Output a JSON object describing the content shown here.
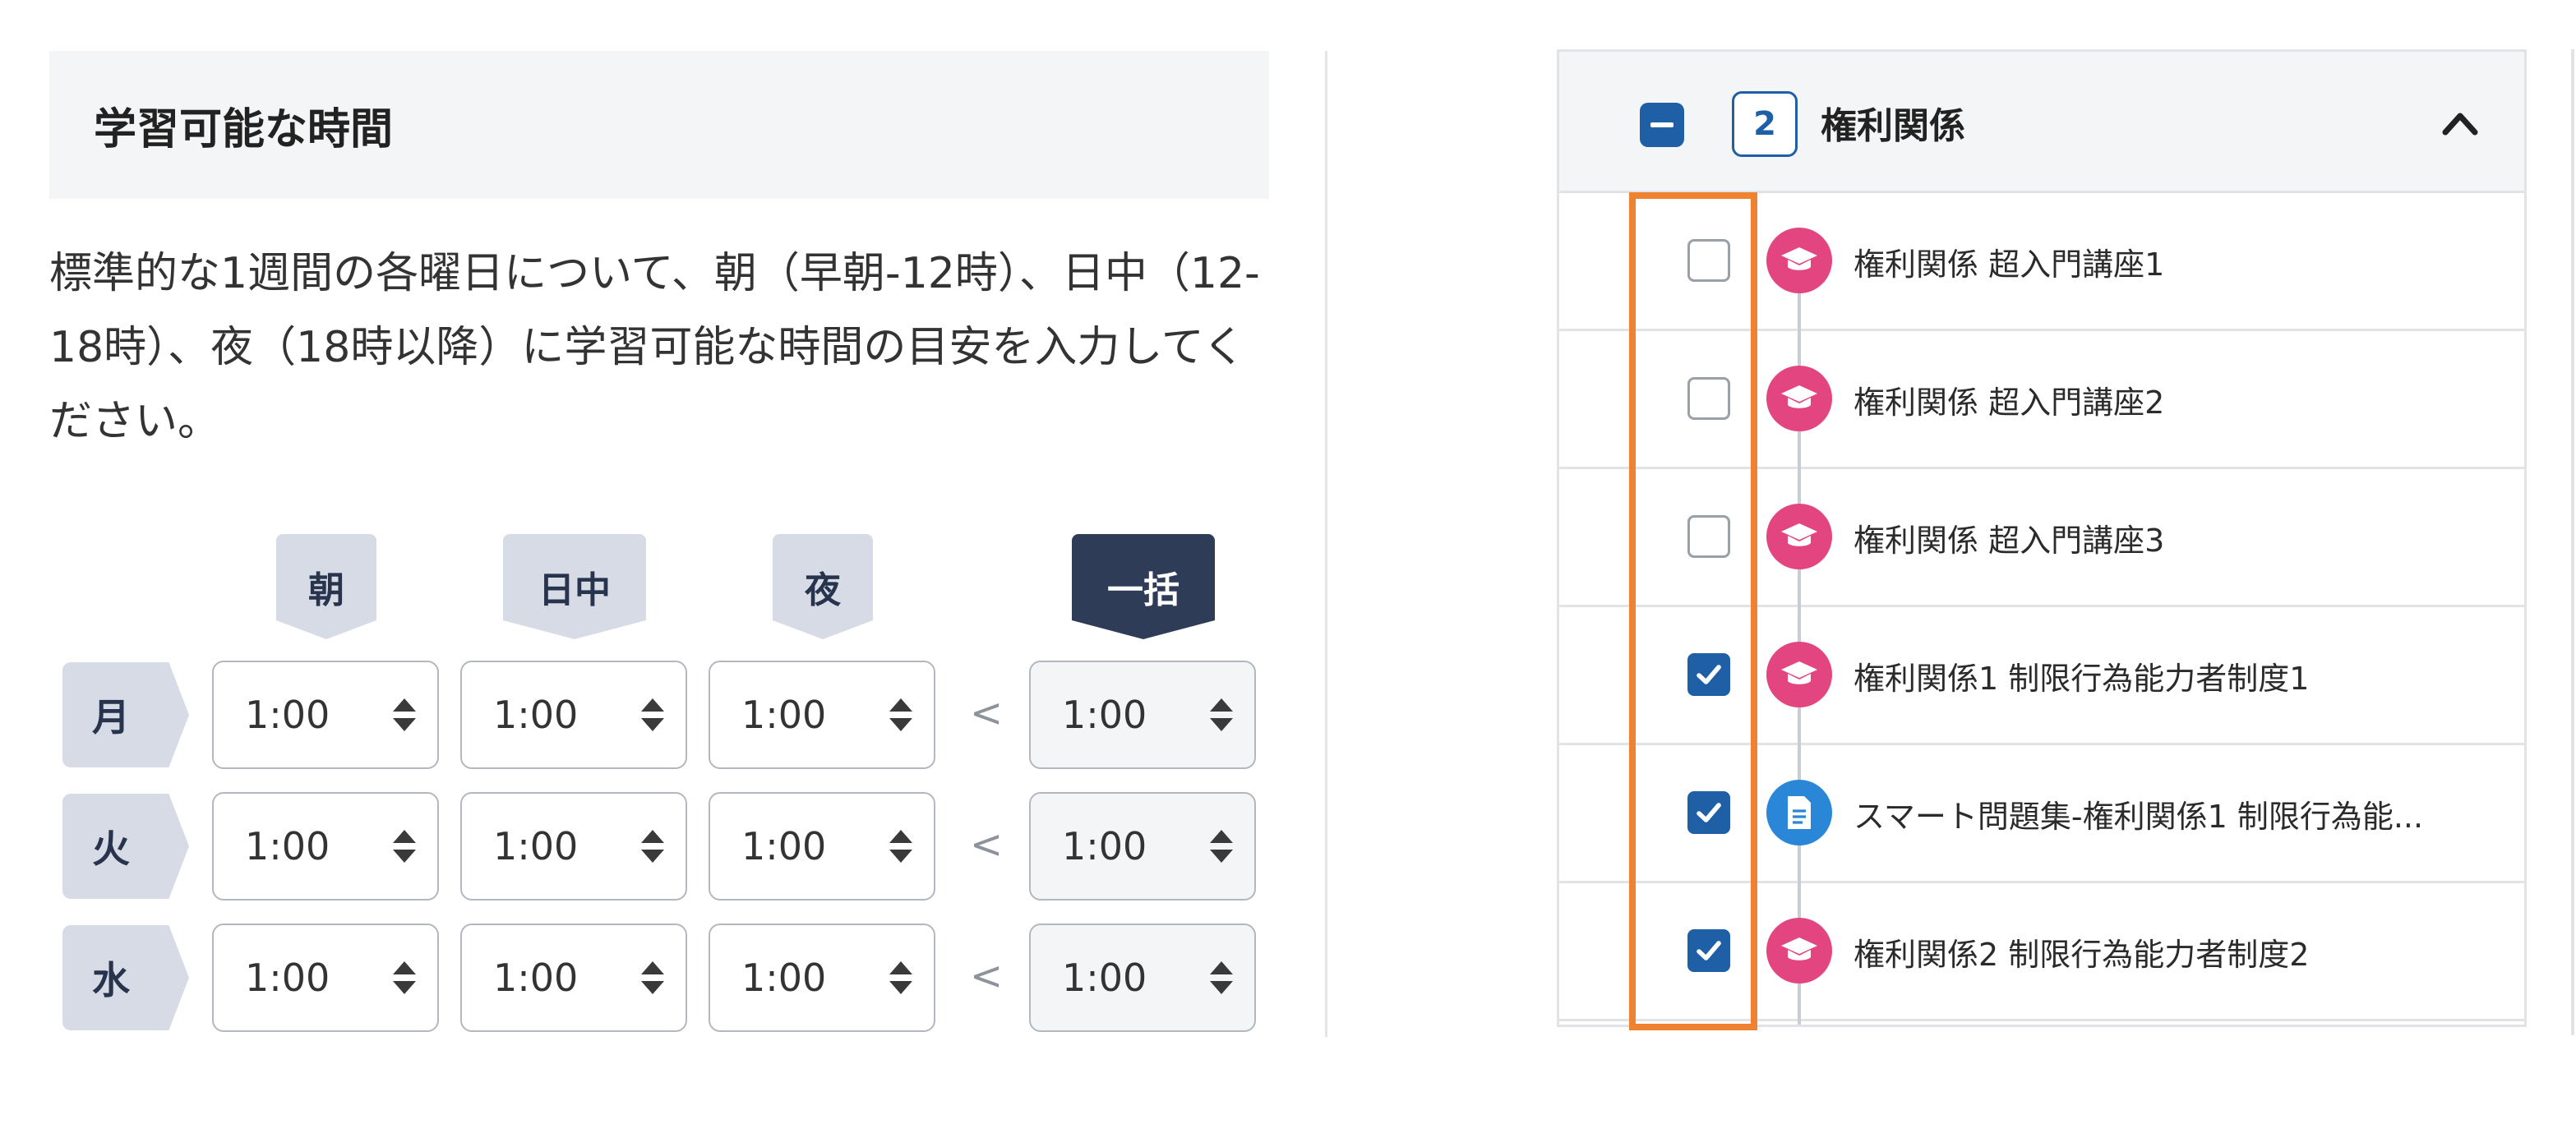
{
  "left_panel": {
    "title": "学習可能な時間",
    "description": "標準的な1週間の各曜日について、朝（早朝-12時）、日中（12-18時）、夜（18時以降）に学習可能な時間の目安を入力してください。",
    "columns": [
      "朝",
      "日中",
      "夜",
      "一括"
    ],
    "separator": "<",
    "rows": [
      {
        "day": "月",
        "morning": "1:00",
        "daytime": "1:00",
        "night": "1:00",
        "bulk": "1:00"
      },
      {
        "day": "火",
        "morning": "1:00",
        "daytime": "1:00",
        "night": "1:00",
        "bulk": "1:00"
      },
      {
        "day": "水",
        "morning": "1:00",
        "daytime": "1:00",
        "night": "1:00",
        "bulk": "1:00"
      }
    ]
  },
  "right_panel": {
    "section_number": "2",
    "section_title": "権利関係",
    "items": [
      {
        "label": "権利関係 超入門講座1",
        "checked": false,
        "icon": "graduation-cap-icon"
      },
      {
        "label": "権利関係 超入門講座2",
        "checked": false,
        "icon": "graduation-cap-icon"
      },
      {
        "label": "権利関係 超入門講座3",
        "checked": false,
        "icon": "graduation-cap-icon"
      },
      {
        "label": "権利関係1 制限行為能力者制度1",
        "checked": true,
        "icon": "graduation-cap-icon"
      },
      {
        "label": "スマート問題集-権利関係1 制限行為能...",
        "checked": true,
        "icon": "document-icon"
      },
      {
        "label": "権利関係2 制限行為能力者制度2",
        "checked": true,
        "icon": "graduation-cap-icon"
      }
    ]
  },
  "colors": {
    "accent_blue": "#1f5fa6",
    "lecture_pink": "#e2457f",
    "document_blue": "#2a86d7",
    "highlight_orange": "#ee8230",
    "tag_bg": "#d7dbe5",
    "tag_dark_bg": "#2f3c58"
  }
}
